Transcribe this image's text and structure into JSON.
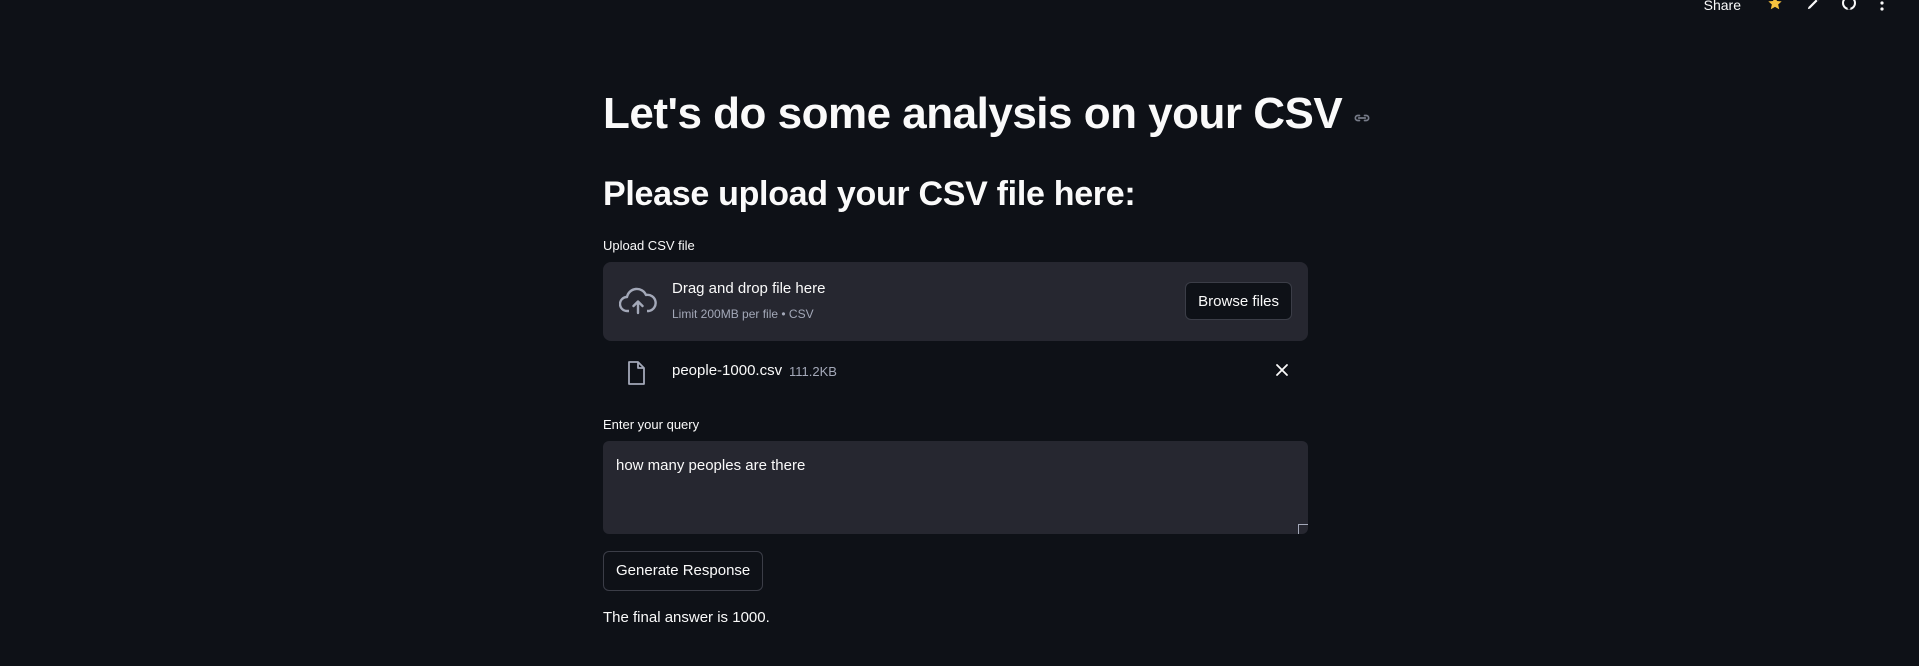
{
  "header": {
    "share_label": "Share",
    "icons": [
      "star-icon",
      "pencil-icon",
      "github-icon",
      "more-menu-icon"
    ]
  },
  "main": {
    "title": "Let's do some analysis on your CSV",
    "subtitle": "Please upload your CSV file here:"
  },
  "uploader": {
    "label": "Upload CSV file",
    "drop_text": "Drag and drop file here",
    "limit_text": "Limit 200MB per file • CSV",
    "browse_label": "Browse files"
  },
  "file": {
    "name": "people-1000.csv",
    "size": "111.2KB"
  },
  "query": {
    "label": "Enter your query",
    "value": "how many peoples are there"
  },
  "actions": {
    "generate_label": "Generate Response"
  },
  "result": {
    "answer": "The final answer is 1000."
  },
  "colors": {
    "background": "#0e1117",
    "panel": "#262730",
    "text": "#fafafa",
    "muted": "#a3a8b8",
    "star": "#f6c23e"
  }
}
